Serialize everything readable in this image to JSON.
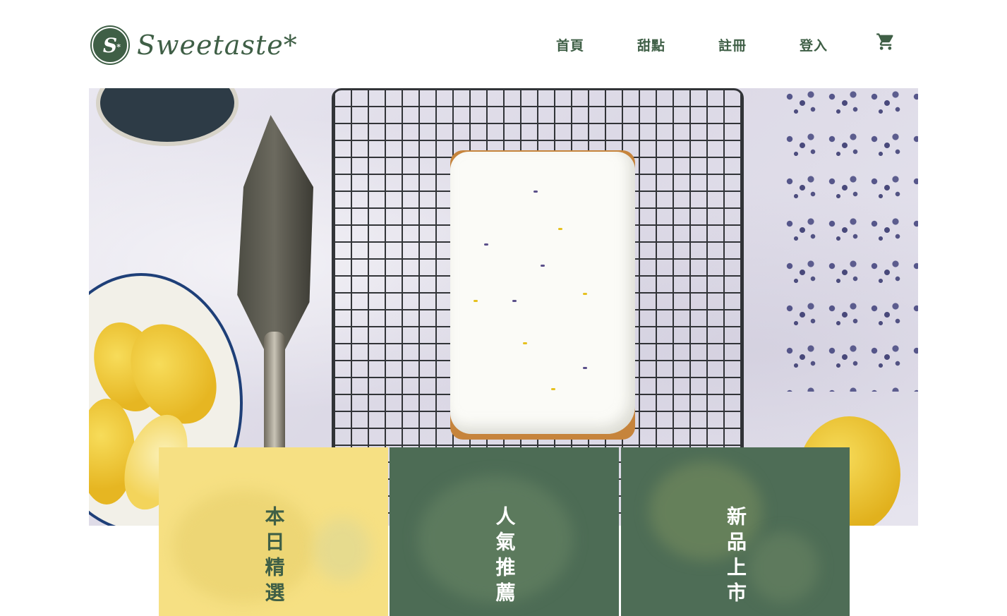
{
  "brand": {
    "badge_letter": "S",
    "badge_star": "*",
    "name": "Sweetaste*",
    "color": "#3f5f46"
  },
  "nav": {
    "items": [
      "首頁",
      "甜點",
      "註冊",
      "登入"
    ],
    "cart_icon": "shopping-cart-icon"
  },
  "hero": {
    "alt": "lemon-lavender-pound-cake-image"
  },
  "categories": [
    {
      "label": "本日精選",
      "bg": "#f6e083",
      "fg": "#3f5f46"
    },
    {
      "label": "人氣推薦",
      "bg": "#4d6c55",
      "fg": "#ffffff"
    },
    {
      "label": "新品上市",
      "bg": "#4e6d56",
      "fg": "#ffffff"
    }
  ]
}
